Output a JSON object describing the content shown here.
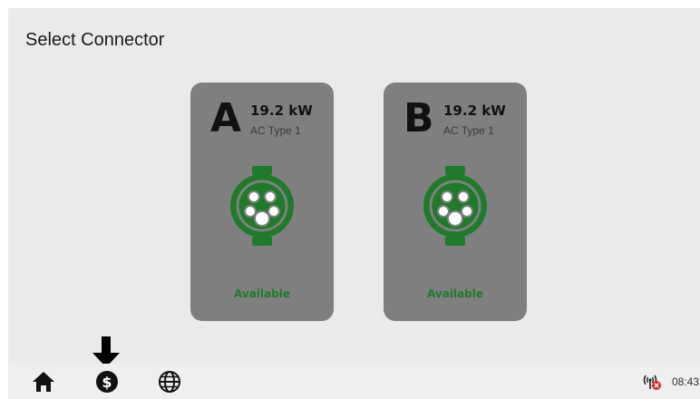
{
  "page": {
    "title": "Select Connector"
  },
  "connectors": [
    {
      "letter": "A",
      "power": "19.2 kW",
      "type": "AC Type 1",
      "status": "Available",
      "icon": "ev-plug-icon"
    },
    {
      "letter": "B",
      "power": "19.2 kW",
      "type": "AC Type 1",
      "status": "Available",
      "icon": "ev-plug-icon"
    }
  ],
  "bottom_bar": {
    "items": [
      {
        "icon": "home-icon"
      },
      {
        "icon": "dollar-icon"
      },
      {
        "icon": "globe-icon"
      }
    ],
    "status_icon": "signal-error-icon",
    "time": "08:43"
  },
  "colors": {
    "background": "#e9eaec",
    "card": "#7f7f80",
    "accent_green": "#1f7a2a",
    "status_red": "#e02424"
  }
}
